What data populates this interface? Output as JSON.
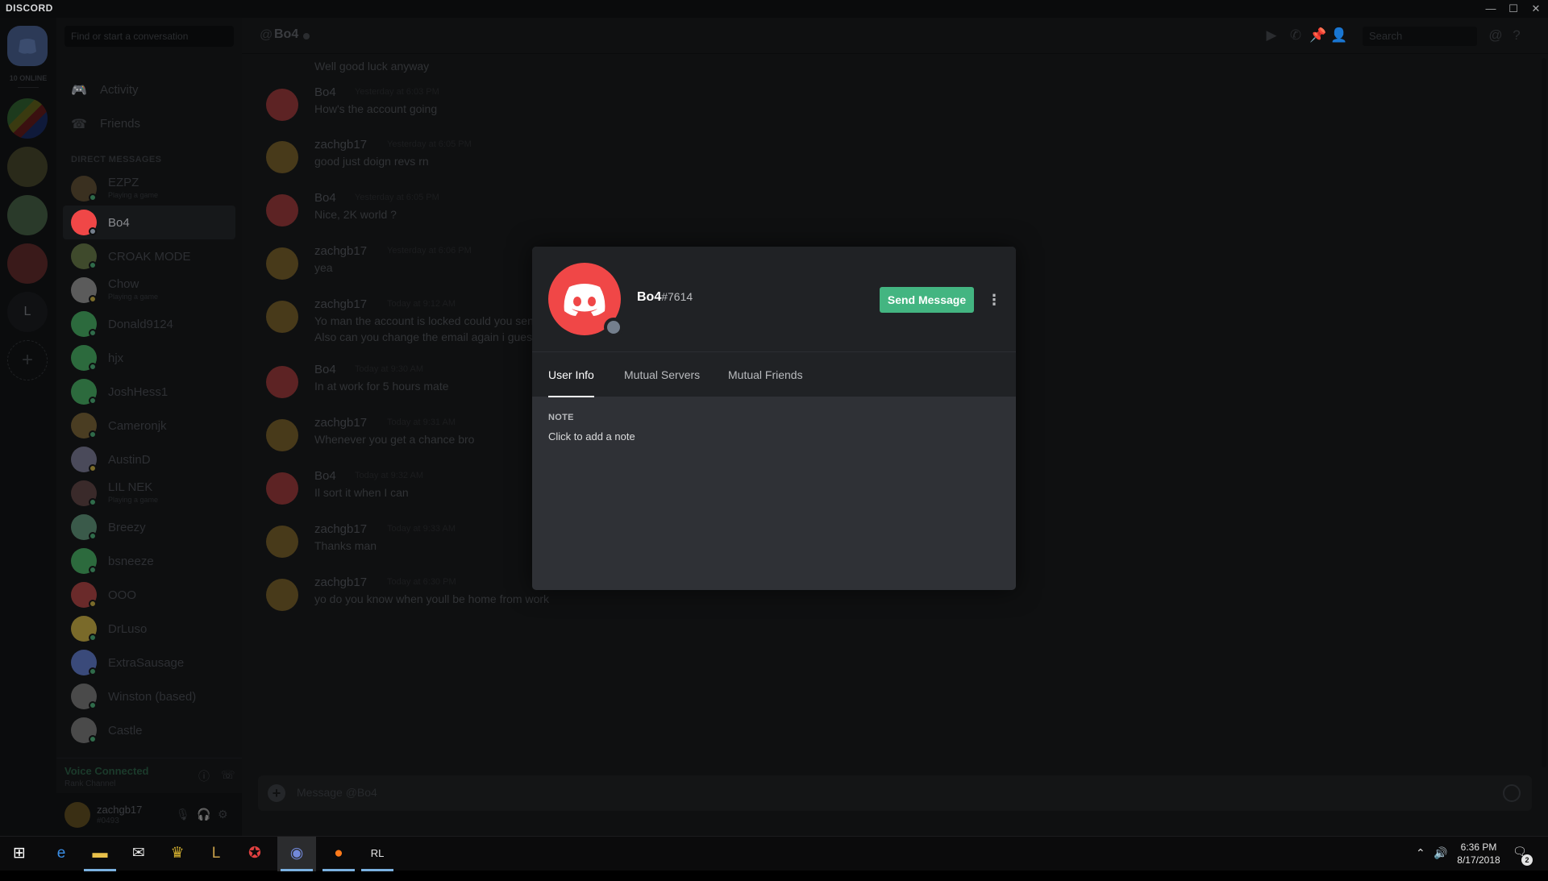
{
  "app": {
    "title": "DISCORD",
    "online_count": "10 ONLINE"
  },
  "window_controls": {
    "minimize": "—",
    "maximize": "☐",
    "close": "✕"
  },
  "servers": {
    "letter": "L",
    "add": "+"
  },
  "sidebar": {
    "search_placeholder": "Find or start a conversation",
    "nav": [
      {
        "label": "Activity",
        "icon": "gamepad-icon"
      },
      {
        "label": "Friends",
        "icon": "friends-icon"
      }
    ],
    "dm_header": "DIRECT MESSAGES",
    "dms": [
      {
        "name": "EZPZ",
        "sub": "Playing a game",
        "avatar_color": "#3a3020",
        "status": "#2f6b4a"
      },
      {
        "name": "Bo4",
        "sub": "",
        "avatar_color": "#f04747",
        "status": "#747f8d",
        "active": true
      },
      {
        "name": "CROAK MODE",
        "sub": "",
        "avatar_color": "#3f4a2c",
        "status": "#2f6b4a"
      },
      {
        "name": "Chow",
        "sub": "Playing a game",
        "avatar_color": "#5b5b5b",
        "status": "#7a6b2a"
      },
      {
        "name": "Donald9124",
        "sub": "",
        "avatar_color": "#2c6a3d",
        "status": "#2f6b4a"
      },
      {
        "name": "hjx",
        "sub": "",
        "avatar_color": "#2c6a3d",
        "status": "#2f6b4a"
      },
      {
        "name": "JoshHess1",
        "sub": "",
        "avatar_color": "#2c6a3d",
        "status": "#2f6b4a"
      },
      {
        "name": "Cameronjk",
        "sub": "",
        "avatar_color": "#4a3d22",
        "status": "#2f6b4a"
      },
      {
        "name": "AustinD",
        "sub": "",
        "avatar_color": "#4a4a5a",
        "status": "#7a6b2a"
      },
      {
        "name": "LIL NEK",
        "sub": "Playing a game",
        "avatar_color": "#3a2a2a",
        "status": "#2f6b4a"
      },
      {
        "name": "Breezy",
        "sub": "",
        "avatar_color": "#3a5a4a",
        "status": "#2f6b4a"
      },
      {
        "name": "bsneeze",
        "sub": "",
        "avatar_color": "#2c6a3d",
        "status": "#2f6b4a"
      },
      {
        "name": "OOO",
        "sub": "",
        "avatar_color": "#6a2a2a",
        "status": "#7a6b2a"
      },
      {
        "name": "DrLuso",
        "sub": "",
        "avatar_color": "#7a6a2a",
        "status": "#2f6b4a"
      },
      {
        "name": "ExtraSausage",
        "sub": "",
        "avatar_color": "#3a4a7a",
        "status": "#2f6b4a"
      },
      {
        "name": "Winston (based)",
        "sub": "",
        "avatar_color": "#4a4a4a",
        "status": "#2f6b4a"
      },
      {
        "name": "Castle",
        "sub": "",
        "avatar_color": "#4a4a4a",
        "status": "#2f6b4a"
      }
    ],
    "voice": {
      "title": "Voice Connected",
      "sub": "Rank Channel"
    },
    "user": {
      "name": "zachgb17",
      "discriminator": "#0493"
    }
  },
  "chat": {
    "channel_name": "Bo4",
    "search_placeholder": "Search",
    "top_text": "Well good luck anyway",
    "messages": [
      {
        "author": "Bo4",
        "time": "Yesterday at 6:03 PM",
        "text": "How's the account going",
        "text2": "",
        "avatar": "#f04747"
      },
      {
        "author": "zachgb17",
        "time": "Yesterday at 6:05 PM",
        "text": "good just doign revs rn",
        "text2": "",
        "avatar": "#b48a2a"
      },
      {
        "author": "Bo4",
        "time": "Yesterday at 6:05 PM",
        "text": "Nice, 2K world ?",
        "text2": "",
        "avatar": "#f04747"
      },
      {
        "author": "zachgb17",
        "time": "Yesterday at 6:06 PM",
        "text": "yea",
        "text2": "",
        "avatar": "#b48a2a"
      },
      {
        "author": "zachgb17",
        "time": "Today at 9:12 AM",
        "text": "Yo man the account is locked could you sen",
        "text2": "Also can you change the email again i guess",
        "avatar": "#b48a2a"
      },
      {
        "author": "Bo4",
        "time": "Today at 9:30 AM",
        "text": "In at work for 5 hours mate",
        "text2": "",
        "avatar": "#f04747"
      },
      {
        "author": "zachgb17",
        "time": "Today at 9:31 AM",
        "text": "Whenever you get a chance bro",
        "text2": "",
        "avatar": "#b48a2a"
      },
      {
        "author": "Bo4",
        "time": "Today at 9:32 AM",
        "text": "Il sort it when I can",
        "text2": "",
        "avatar": "#f04747"
      },
      {
        "author": "zachgb17",
        "time": "Today at 9:33 AM",
        "text": "Thanks man",
        "text2": "",
        "avatar": "#b48a2a"
      },
      {
        "author": "zachgb17",
        "time": "Today at 6:30 PM",
        "text": "yo do you know when youll be home from work",
        "text2": "",
        "avatar": "#b48a2a"
      }
    ],
    "composer_placeholder": "Message @Bo4"
  },
  "modal": {
    "username": "Bo4",
    "discriminator": "#7614",
    "send_button": "Send Message",
    "more_icon": "⋮",
    "tabs": [
      {
        "label": "User Info",
        "active": true
      },
      {
        "label": "Mutual Servers",
        "active": false
      },
      {
        "label": "Mutual Friends",
        "active": false
      }
    ],
    "note_label": "NOTE",
    "note_placeholder": "Click to add a note",
    "accent": "#43b581",
    "avatar_color": "#f04747",
    "status_color": "#747f8d"
  },
  "taskbar": {
    "time": "6:36 PM",
    "date": "8/17/2018",
    "notification_count": "2",
    "apps": [
      {
        "name": "start",
        "glyph": "⊞",
        "color": "#ffffff"
      },
      {
        "name": "edge",
        "glyph": "e",
        "color": "#3a8ee6"
      },
      {
        "name": "file-explorer",
        "glyph": "▬",
        "color": "#e8c04a"
      },
      {
        "name": "mail",
        "glyph": "✉",
        "color": "#e4e4e4"
      },
      {
        "name": "app-crown",
        "glyph": "♛",
        "color": "#d4b030"
      },
      {
        "name": "league",
        "glyph": "L",
        "color": "#c8a04a"
      },
      {
        "name": "app-red",
        "glyph": "✪",
        "color": "#e04040"
      },
      {
        "name": "discord",
        "glyph": "◉",
        "color": "#7289da"
      },
      {
        "name": "firefox",
        "glyph": "●",
        "color": "#ff7a1a"
      },
      {
        "name": "rocket-league",
        "glyph": "RL",
        "color": "#e4e4e4"
      }
    ]
  }
}
